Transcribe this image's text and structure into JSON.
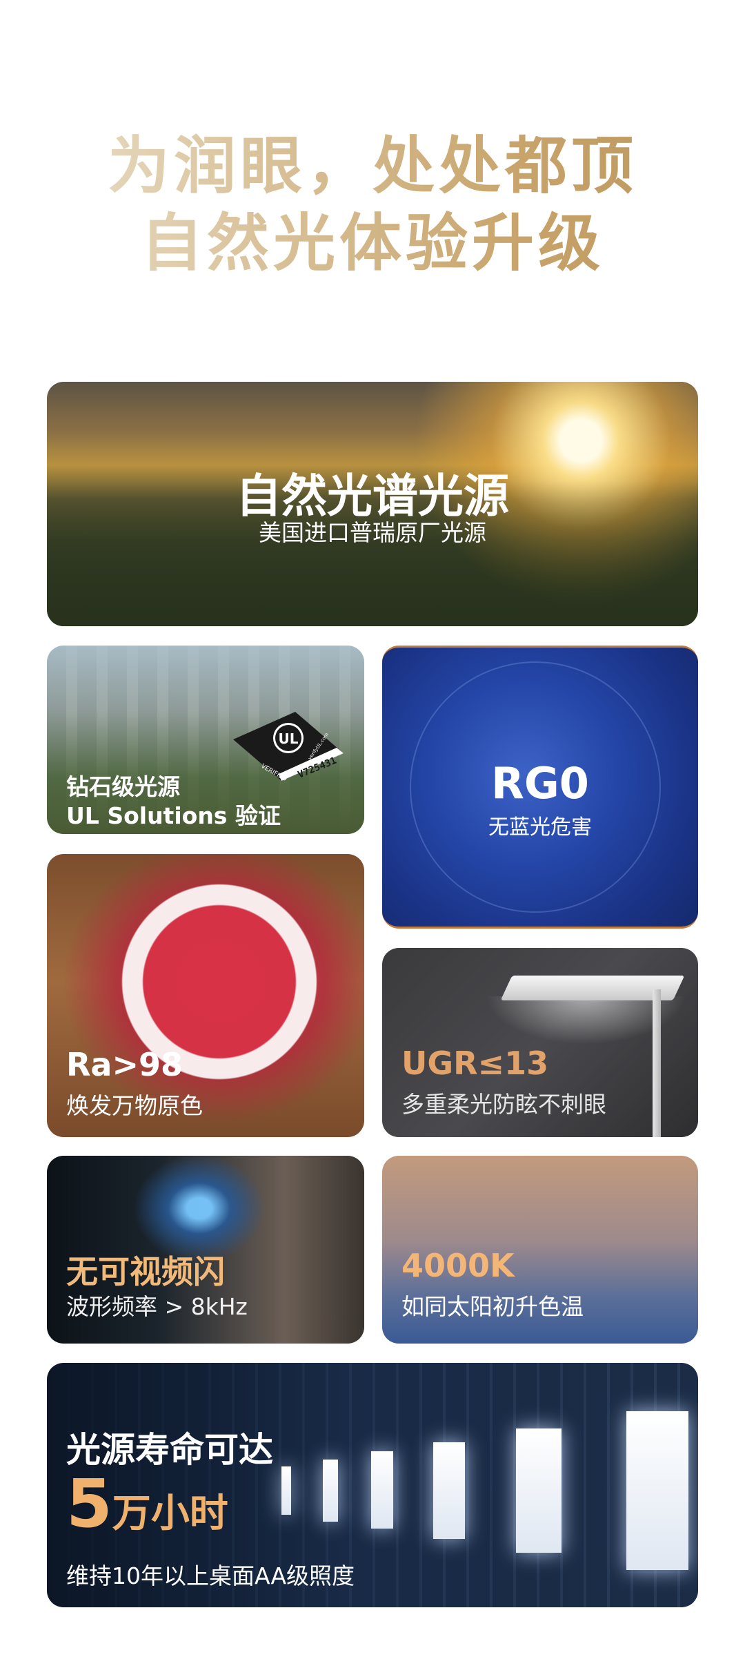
{
  "headline": {
    "line1": "为润眼，处处都顶",
    "line2": "自然光体验升级"
  },
  "cards": {
    "spectrum": {
      "title": "自然光谱光源",
      "subtitle": "美国进口普瑞原厂光源"
    },
    "ul": {
      "title": "钻石级光源",
      "subtitle": "UL Solutions 验证",
      "badge": {
        "mark": "UL",
        "verified": "VERIFIED",
        "site": "verifyUL.com",
        "code": "V725431"
      }
    },
    "rg0": {
      "title": "RG0",
      "subtitle": "无蓝光危害"
    },
    "ra": {
      "title": "Ra>98",
      "subtitle": "焕发万物原色"
    },
    "ugr": {
      "title": "UGR≤13",
      "subtitle": "多重柔光防眩不刺眼"
    },
    "flicker": {
      "title": "无可视频闪",
      "subtitle": "波形频率 > 8kHz"
    },
    "cct": {
      "title": "4000K",
      "subtitle": "如同太阳初升色温"
    },
    "lifetime": {
      "title": "光源寿命可达",
      "value": "5",
      "unit": "万小时",
      "subtitle": "维持10年以上桌面AA级照度"
    }
  },
  "colors": {
    "headline_gradient": [
      "#ece3cf",
      "#c8a46b"
    ],
    "accent_gold": "#f0b16d",
    "rg0_blue": "#2446a8"
  }
}
